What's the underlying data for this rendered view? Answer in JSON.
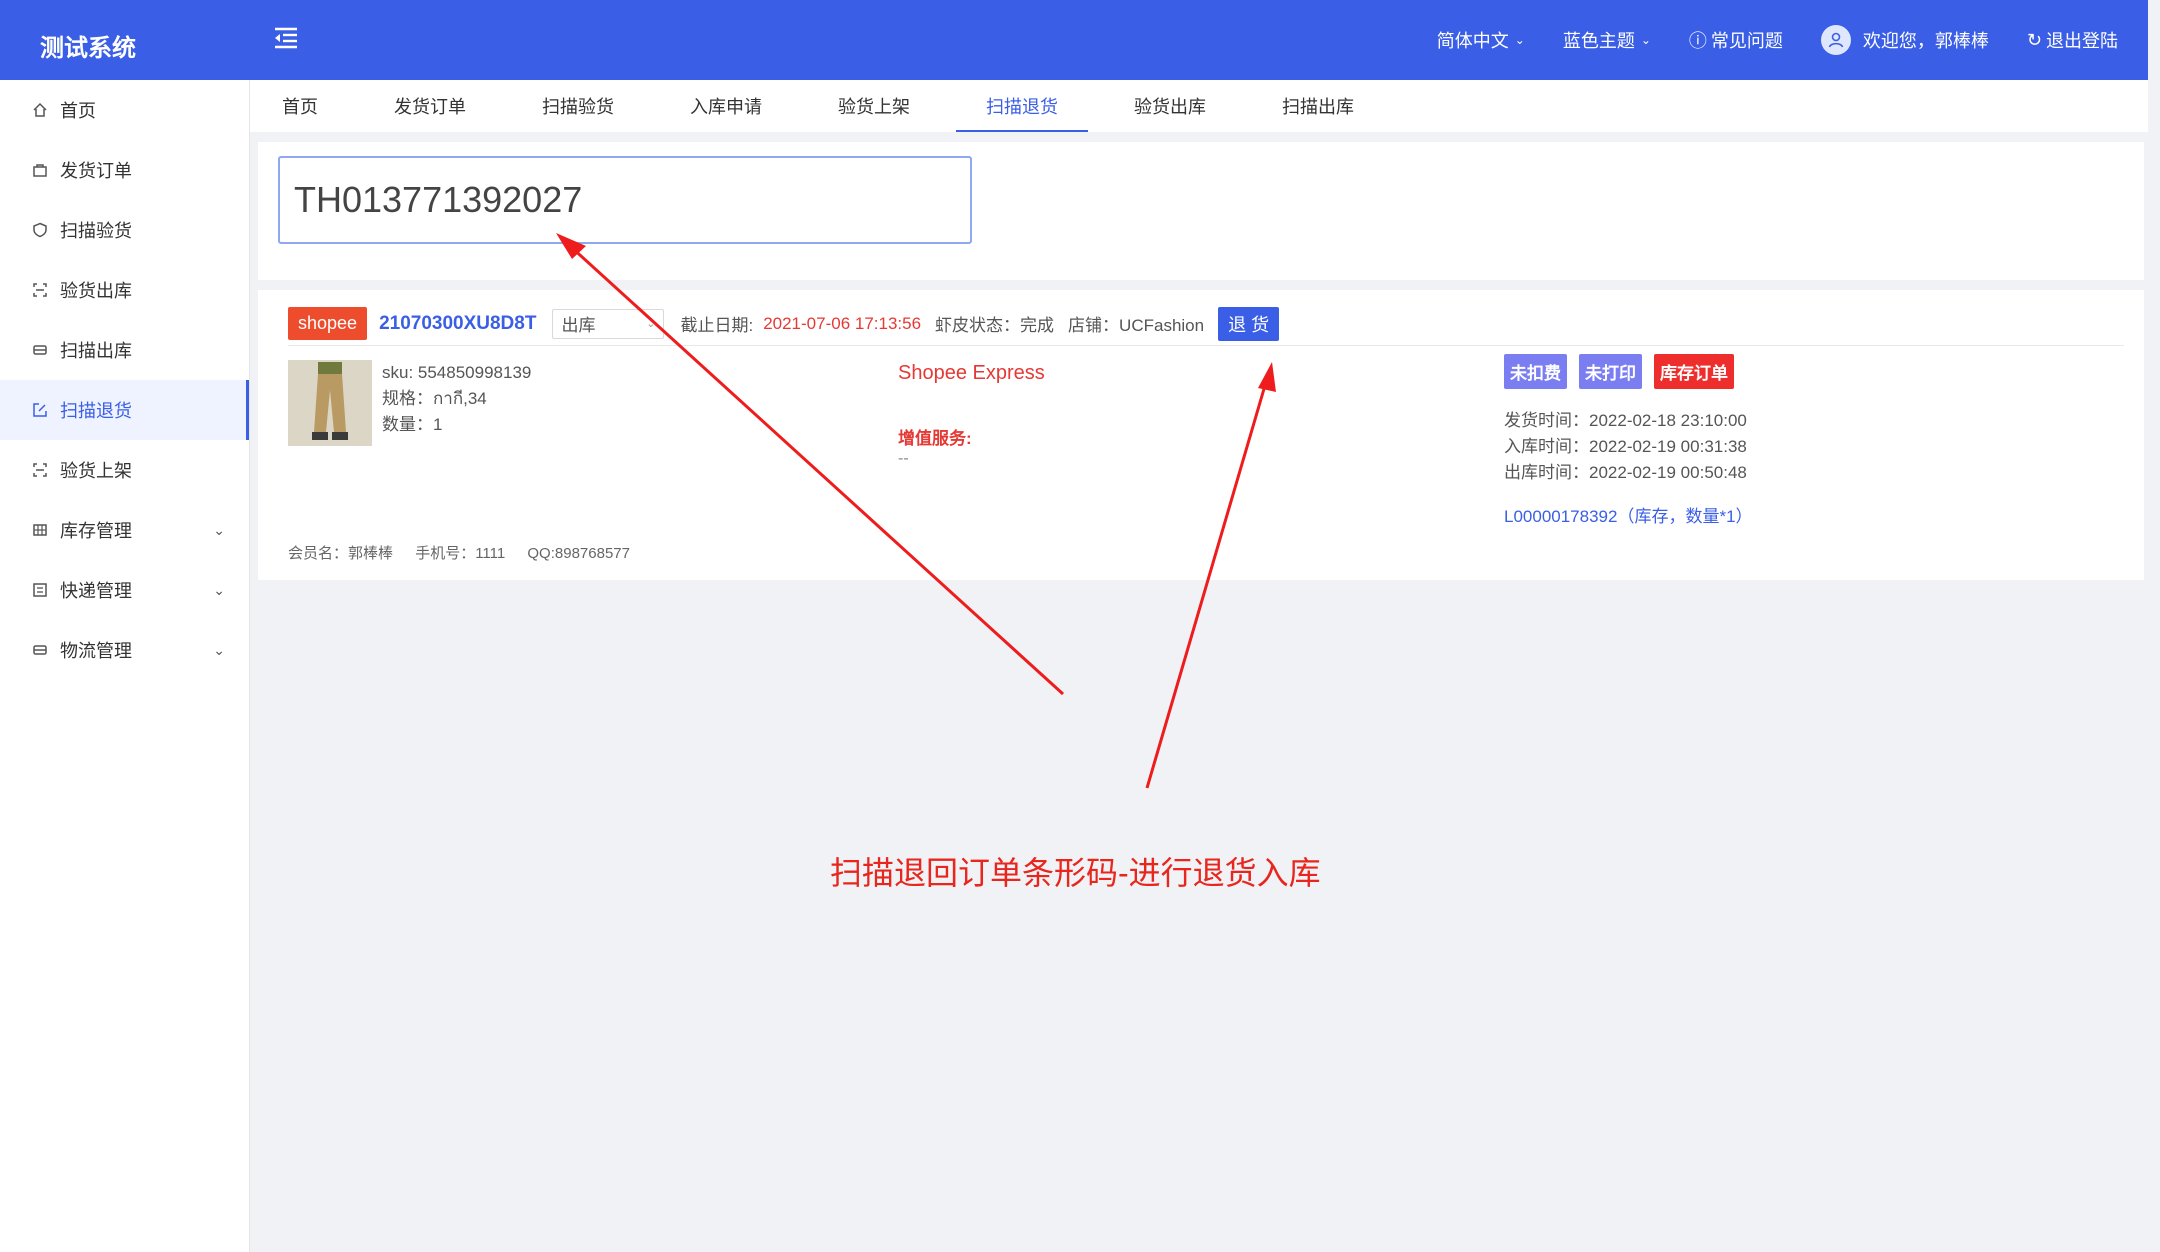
{
  "header": {
    "logo": "测试系统",
    "language": "简体中文",
    "theme": "蓝色主题",
    "faq": "常见问题",
    "welcome": "欢迎您，郭棒棒",
    "logout": "退出登陆"
  },
  "sidebar": {
    "items": [
      {
        "label": "首页"
      },
      {
        "label": "发货订单"
      },
      {
        "label": "扫描验货"
      },
      {
        "label": "验货出库"
      },
      {
        "label": "扫描出库"
      },
      {
        "label": "扫描退货"
      },
      {
        "label": "验货上架"
      },
      {
        "label": "库存管理"
      },
      {
        "label": "快递管理"
      },
      {
        "label": "物流管理"
      }
    ]
  },
  "tabs": [
    "首页",
    "发货订单",
    "扫描验货",
    "入库申请",
    "验货上架",
    "扫描退货",
    "验货出库",
    "扫描出库"
  ],
  "search": {
    "value": "TH013771392027"
  },
  "order": {
    "platform": "shopee",
    "order_no": "21070300XU8D8T",
    "status": "出库",
    "deadline_label": "截止日期:",
    "deadline": "2021-07-06 17:13:56",
    "shopee_status": "虾皮状态：完成",
    "shop": "店铺：UCFashion",
    "return_button": "退 货",
    "sku": "sku: 554850998139",
    "spec": "规格：กากี,34",
    "qty": "数量：1",
    "shipping": "Shopee Express",
    "value_added_label": "增值服务:",
    "value_added": "--",
    "badges": [
      "未扣费",
      "未打印",
      "库存订单"
    ],
    "ship_time": "发货时间：2022-02-18 23:10:00",
    "in_time": "入库时间：2022-02-19 00:31:38",
    "out_time": "出库时间：2022-02-19 00:50:48",
    "stock_link": "L00000178392（库存，数量*1）",
    "member": "会员名：郭棒棒",
    "phone": "手机号：1111",
    "qq": "QQ:898768577"
  },
  "annotation": "扫描退回订单条形码-进行退货入库",
  "colors": {
    "primary": "#3a5ee6",
    "shopee": "#ee4d2d",
    "annotation": "#e8261d"
  }
}
